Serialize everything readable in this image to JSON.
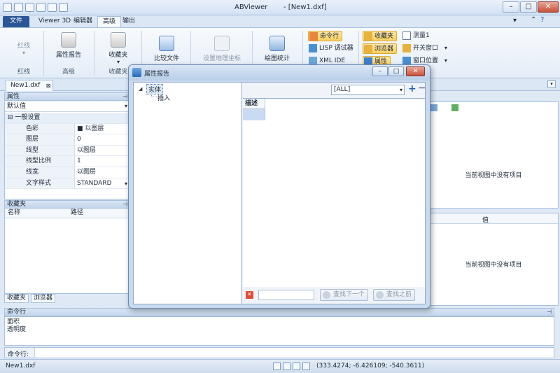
{
  "window": {
    "app_title": "ABViewer",
    "doc_title": "- [New1.dxf]"
  },
  "ribbon_tabs": [
    "文件",
    "Viewer 3D",
    "编辑器",
    "高级",
    "输出"
  ],
  "ribbon": {
    "redline": "红线",
    "redline_group": "红线",
    "property_report": "属性报告",
    "advanced_group": "高级",
    "favorites": "收藏夹",
    "favorites_group": "收藏夹",
    "compare_files": "比较文件",
    "set_geo_coords": "设置地理坐标",
    "drawing_stats": "绘图统计",
    "command_line": "命令行",
    "lisp_debugger": "LISP 调试器",
    "xml_ide": "XML IDE",
    "favorites_small": "收藏夹",
    "browser": "浏览器",
    "properties": "属性",
    "measure": "测量1",
    "toggle_window": "开关窗口",
    "window_position": "窗口位置"
  },
  "doc_tab": "New1.dxf",
  "properties_panel": {
    "title": "属性",
    "combo": "默认值",
    "rows": [
      {
        "name": "一般设置",
        "value": ""
      },
      {
        "name": "色彩",
        "value": "■ 以图层"
      },
      {
        "name": "图层",
        "value": "0"
      },
      {
        "name": "线型",
        "value": "以图层"
      },
      {
        "name": "线型比例",
        "value": "1"
      },
      {
        "name": "线宽",
        "value": "以图层"
      },
      {
        "name": "文字样式",
        "value": "STANDARD"
      }
    ]
  },
  "favorites_panel": {
    "title": "收藏夹",
    "col_name": "名称",
    "col_path": "路径",
    "tabs": [
      "收藏夹",
      "浏览器"
    ]
  },
  "right_panels": {
    "empty_top": "当前视图中没有项目",
    "value_col": "值",
    "empty_bottom": "当前视图中没有项目"
  },
  "command": {
    "title": "命令行",
    "log": [
      "面积",
      "透明度"
    ],
    "label": "命令行:",
    "value": ""
  },
  "status": {
    "file": "New1.dxf",
    "coords": "(333.4274; -6.426109; -540.3611)"
  },
  "dialog": {
    "title": "属性报告",
    "tree_root": "实体",
    "tree_child": "插入",
    "filter": "[ALL]",
    "grid_header": "描述",
    "find_next": "查找下一个",
    "find_prev": "查找之前"
  }
}
